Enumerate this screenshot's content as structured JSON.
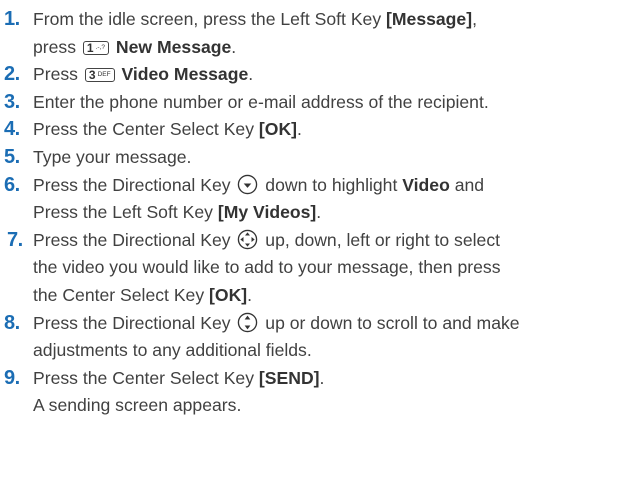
{
  "steps": [
    {
      "num": "1.",
      "lines": [
        {
          "a": "From the idle screen, press the Left Soft Key ",
          "b": "[Message]",
          "c": ","
        },
        {
          "a": "press ",
          "key_num": "1",
          "key_sym": ".-,?",
          "b": "New Message",
          "c": "."
        }
      ]
    },
    {
      "num": "2.",
      "lines": [
        {
          "a": "Press ",
          "key_num": "3",
          "key_sym": "DEF",
          "b": "Video Message",
          "c": "."
        }
      ]
    },
    {
      "num": "3.",
      "lines": [
        {
          "a": "Enter the phone number or e-mail address of the recipient."
        }
      ]
    },
    {
      "num": "4.",
      "lines": [
        {
          "a": "Press the Center Select Key ",
          "b": "[OK]",
          "c": "."
        }
      ]
    },
    {
      "num": "5.",
      "lines": [
        {
          "a": "Type your message."
        }
      ]
    },
    {
      "num": "6.",
      "lines": [
        {
          "a": "Press the Directional Key ",
          "icon": "nav-down-icon",
          "a2": " down to highlight ",
          "b": "Video",
          "c": " and"
        },
        {
          "a": "Press the Left Soft Key ",
          "b": "[My Videos]",
          "c": "."
        }
      ]
    },
    {
      "num": "7.",
      "lines": [
        {
          "a": "Press the Directional Key ",
          "icon": "nav-4way-icon",
          "a2": " up, down, left or right to select"
        },
        {
          "a": "the video you would like to add to your message, then press"
        },
        {
          "a": "the Center Select Key ",
          "b": "[OK]",
          "c": "."
        }
      ]
    },
    {
      "num": "8.",
      "lines": [
        {
          "a": "Press the Directional Key ",
          "icon": "nav-updown-icon",
          "a2": " up or down to scroll to and make"
        },
        {
          "a": "adjustments to any additional fields."
        }
      ]
    },
    {
      "num": "9.",
      "lines": [
        {
          "a": "Press the Center Select Key ",
          "b": "[SEND]",
          "c": "."
        },
        {
          "a": "A sending screen appears."
        }
      ]
    }
  ],
  "colors": {
    "number": "#1b6db4",
    "text": "#414141"
  }
}
